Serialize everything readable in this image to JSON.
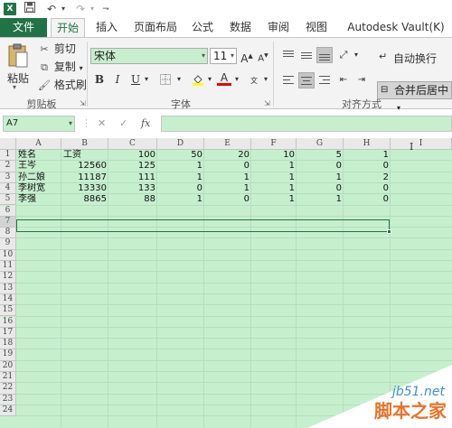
{
  "quick_access": {
    "app_icon": "X",
    "save_icon": "save-icon",
    "undo_icon": "undo-icon",
    "redo_icon": "redo-icon"
  },
  "tabs": [
    {
      "label": "文件"
    },
    {
      "label": "开始"
    },
    {
      "label": "插入"
    },
    {
      "label": "页面布局"
    },
    {
      "label": "公式"
    },
    {
      "label": "数据"
    },
    {
      "label": "审阅"
    },
    {
      "label": "视图"
    },
    {
      "label": "Autodesk Vault(K)"
    }
  ],
  "ribbon": {
    "clipboard": {
      "paste": "粘贴",
      "cut": "剪切",
      "copy": "复制",
      "format_painter": "格式刷",
      "group_label": "剪贴板"
    },
    "font": {
      "font_name": "宋体",
      "font_size": "11",
      "grow": "A",
      "shrink": "A",
      "bold": "B",
      "italic": "I",
      "underline": "U",
      "font_color": "A",
      "group_label": "字体"
    },
    "alignment": {
      "wrap_text": "自动换行",
      "merge_center": "合并后居中",
      "group_label": "对齐方式"
    }
  },
  "formula_bar": {
    "name_box": "A7",
    "cancel": "✕",
    "enter": "✓",
    "fx": "fx",
    "content": ""
  },
  "columns": [
    "A",
    "B",
    "C",
    "D",
    "E",
    "F",
    "G",
    "H",
    "I"
  ],
  "rows": [
    "1",
    "2",
    "3",
    "4",
    "5",
    "6",
    "7",
    "8",
    "9",
    "10",
    "11",
    "12",
    "13",
    "14",
    "15",
    "16",
    "17",
    "18",
    "19",
    "20",
    "21",
    "22",
    "23",
    "24"
  ],
  "cells": [
    {
      "row": 1,
      "col": "A",
      "value": "姓名",
      "type": "txt"
    },
    {
      "row": 1,
      "col": "B",
      "value": "工资",
      "type": "txt"
    },
    {
      "row": 1,
      "col": "C",
      "value": "100",
      "type": "num"
    },
    {
      "row": 1,
      "col": "D",
      "value": "50",
      "type": "num"
    },
    {
      "row": 1,
      "col": "E",
      "value": "20",
      "type": "num"
    },
    {
      "row": 1,
      "col": "F",
      "value": "10",
      "type": "num"
    },
    {
      "row": 1,
      "col": "G",
      "value": "5",
      "type": "num"
    },
    {
      "row": 1,
      "col": "H",
      "value": "1",
      "type": "num"
    },
    {
      "row": 2,
      "col": "A",
      "value": "王岑",
      "type": "txt"
    },
    {
      "row": 2,
      "col": "B",
      "value": "12560",
      "type": "num"
    },
    {
      "row": 2,
      "col": "C",
      "value": "125",
      "type": "num"
    },
    {
      "row": 2,
      "col": "D",
      "value": "1",
      "type": "num"
    },
    {
      "row": 2,
      "col": "E",
      "value": "0",
      "type": "num"
    },
    {
      "row": 2,
      "col": "F",
      "value": "1",
      "type": "num"
    },
    {
      "row": 2,
      "col": "G",
      "value": "0",
      "type": "num"
    },
    {
      "row": 2,
      "col": "H",
      "value": "0",
      "type": "num"
    },
    {
      "row": 3,
      "col": "A",
      "value": "孙二娘",
      "type": "txt"
    },
    {
      "row": 3,
      "col": "B",
      "value": "11187",
      "type": "num"
    },
    {
      "row": 3,
      "col": "C",
      "value": "111",
      "type": "num"
    },
    {
      "row": 3,
      "col": "D",
      "value": "1",
      "type": "num"
    },
    {
      "row": 3,
      "col": "E",
      "value": "1",
      "type": "num"
    },
    {
      "row": 3,
      "col": "F",
      "value": "1",
      "type": "num"
    },
    {
      "row": 3,
      "col": "G",
      "value": "1",
      "type": "num"
    },
    {
      "row": 3,
      "col": "H",
      "value": "2",
      "type": "num"
    },
    {
      "row": 4,
      "col": "A",
      "value": "李树宽",
      "type": "txt"
    },
    {
      "row": 4,
      "col": "B",
      "value": "13330",
      "type": "num"
    },
    {
      "row": 4,
      "col": "C",
      "value": "133",
      "type": "num"
    },
    {
      "row": 4,
      "col": "D",
      "value": "0",
      "type": "num"
    },
    {
      "row": 4,
      "col": "E",
      "value": "1",
      "type": "num"
    },
    {
      "row": 4,
      "col": "F",
      "value": "1",
      "type": "num"
    },
    {
      "row": 4,
      "col": "G",
      "value": "0",
      "type": "num"
    },
    {
      "row": 4,
      "col": "H",
      "value": "0",
      "type": "num"
    },
    {
      "row": 5,
      "col": "A",
      "value": "李强",
      "type": "txt"
    },
    {
      "row": 5,
      "col": "B",
      "value": "8865",
      "type": "num"
    },
    {
      "row": 5,
      "col": "C",
      "value": "88",
      "type": "num"
    },
    {
      "row": 5,
      "col": "D",
      "value": "1",
      "type": "num"
    },
    {
      "row": 5,
      "col": "E",
      "value": "0",
      "type": "num"
    },
    {
      "row": 5,
      "col": "F",
      "value": "1",
      "type": "num"
    },
    {
      "row": 5,
      "col": "G",
      "value": "1",
      "type": "num"
    },
    {
      "row": 5,
      "col": "H",
      "value": "0",
      "type": "num"
    }
  ],
  "selection": {
    "row": 7
  },
  "watermark": {
    "site": "jb51.net",
    "name": "脚本之家"
  },
  "colors": {
    "accent": "#217346",
    "sheet_bg": "#c6efce"
  }
}
